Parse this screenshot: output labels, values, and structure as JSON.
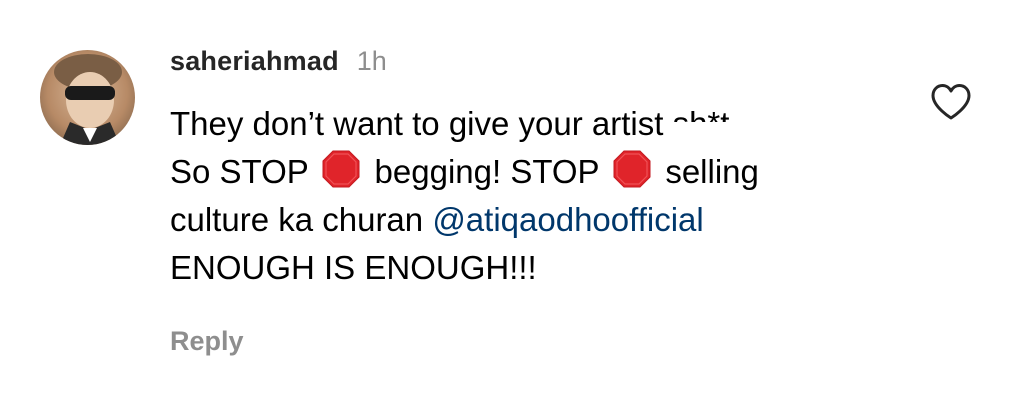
{
  "comment": {
    "username": "saheriahmad",
    "time": "1h",
    "text_line1": "They don’t want to give your artist",
    "text_line1_cut": "sh*t",
    "text_line2_a": "So STOP",
    "text_line2_b": "begging! STOP",
    "text_line2_c": "selling",
    "text_line3_a": "culture ka churan",
    "mention": "@atiqaodhoofficial",
    "text_line4": "ENOUGH IS ENOUGH!!!",
    "reply_label": "Reply",
    "emoji": "stop-sign-icon"
  },
  "colors": {
    "username": "#262626",
    "secondary": "#8e8e8e",
    "mention": "#00376b",
    "stop_sign": "#e0242a"
  }
}
